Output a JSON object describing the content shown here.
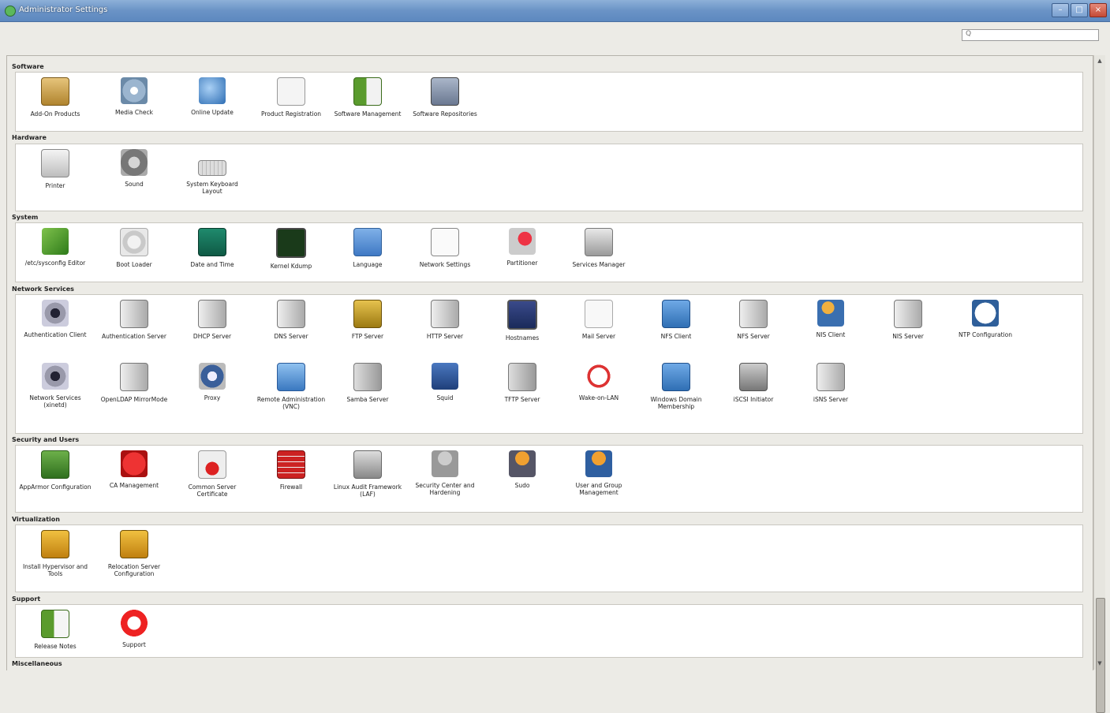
{
  "window": {
    "title": "Administrator Settings",
    "minimize": "–",
    "maximize": "□",
    "close": "×"
  },
  "search": {
    "value": "Q",
    "placeholder": ""
  },
  "sections": {
    "software": {
      "title": "Software",
      "items": [
        {
          "label": "Add-On Products"
        },
        {
          "label": "Media Check"
        },
        {
          "label": "Online Update"
        },
        {
          "label": "Product Registration"
        },
        {
          "label": "Software Management"
        },
        {
          "label": "Software Repositories"
        }
      ]
    },
    "hardware": {
      "title": "Hardware",
      "items": [
        {
          "label": "Printer"
        },
        {
          "label": "Sound"
        },
        {
          "label": "System Keyboard Layout"
        }
      ]
    },
    "system": {
      "title": "System",
      "items": [
        {
          "label": "/etc/sysconfig Editor"
        },
        {
          "label": "Boot Loader"
        },
        {
          "label": "Date and Time"
        },
        {
          "label": "Kernel Kdump"
        },
        {
          "label": "Language"
        },
        {
          "label": "Network Settings"
        },
        {
          "label": "Partitioner"
        },
        {
          "label": "Services Manager"
        }
      ]
    },
    "network": {
      "title": "Network Services",
      "items": [
        {
          "label": "Authentication Client"
        },
        {
          "label": "Authentication Server"
        },
        {
          "label": "DHCP Server"
        },
        {
          "label": "DNS Server"
        },
        {
          "label": "FTP Server"
        },
        {
          "label": "HTTP Server"
        },
        {
          "label": "Hostnames"
        },
        {
          "label": "Mail Server"
        },
        {
          "label": "NFS Client"
        },
        {
          "label": "NFS Server"
        },
        {
          "label": "NIS Client"
        },
        {
          "label": "NIS Server"
        },
        {
          "label": "NTP Configuration"
        },
        {
          "label": "Network Services (xinetd)"
        },
        {
          "label": "OpenLDAP MirrorMode"
        },
        {
          "label": "Proxy"
        },
        {
          "label": "Remote Administration (VNC)"
        },
        {
          "label": "Samba Server"
        },
        {
          "label": "Squid"
        },
        {
          "label": "TFTP Server"
        },
        {
          "label": "Wake-on-LAN"
        },
        {
          "label": "Windows Domain Membership"
        },
        {
          "label": "iSCSI Initiator"
        },
        {
          "label": "iSNS Server"
        }
      ]
    },
    "security": {
      "title": "Security and Users",
      "items": [
        {
          "label": "AppArmor Configuration"
        },
        {
          "label": "CA Management"
        },
        {
          "label": "Common Server Certificate"
        },
        {
          "label": "Firewall"
        },
        {
          "label": "Linux Audit Framework (LAF)"
        },
        {
          "label": "Security Center and Hardening"
        },
        {
          "label": "Sudo"
        },
        {
          "label": "User and Group Management"
        }
      ]
    },
    "virtualization": {
      "title": "Virtualization",
      "items": [
        {
          "label": "Install Hypervisor and Tools"
        },
        {
          "label": "Relocation Server Configuration"
        }
      ]
    },
    "support": {
      "title": "Support",
      "items": [
        {
          "label": "Release Notes"
        },
        {
          "label": "Support"
        }
      ]
    },
    "misc": {
      "title": "Miscellaneous"
    }
  }
}
